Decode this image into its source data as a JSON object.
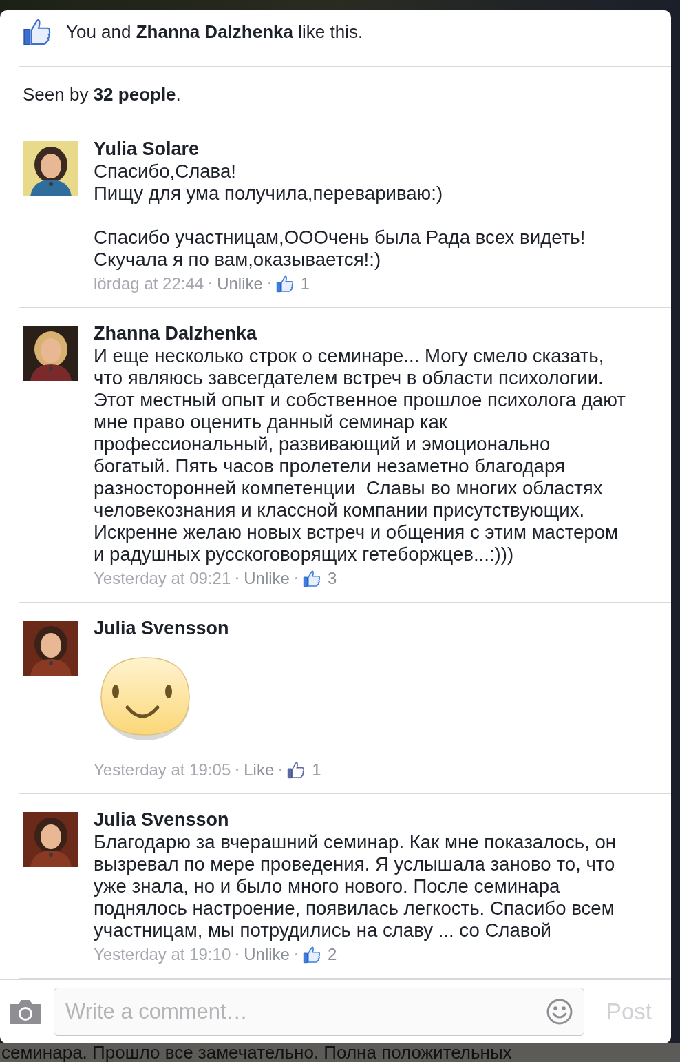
{
  "likes_summary": {
    "text": "You and **Zhanna Dalzhenka** like this."
  },
  "seen_by": {
    "text": "Seen by **32 people**."
  },
  "comments": [
    {
      "author": "Yulia Solare",
      "kind": "text",
      "body": "Спасибо,Слава!\nПищу для ума получила,перевариваю:)\n\nСпасибо участницам,ОООчень была Рада всех видеть!\nСкучала я по вам,оказывается!:)",
      "time": "lördag at 22:44",
      "action": "Unlike",
      "liked": true,
      "likes": "1"
    },
    {
      "author": "Zhanna Dalzhenka",
      "kind": "text",
      "body": "И еще несколько строк о семинаре... Могу смело сказать,\nчто являюсь завсегдателем встреч в области психологии.\nЭтот местный опыт и собственное прошлое психолога дают\nмне право оценить данный семинар как\nпрофессиональный, развивающий и эмоционально\nбогатый. Пять часов пролетели незаметно благодаря\nразносторонней компетенции  Славы во многих областях\nчеловекознания и классной компании присутствующих.\nИскренне желаю новых встреч и общения с этим мастером\nи радушных русскоговорящих гетеборжцев...:)))",
      "time": "Yesterday at 09:21",
      "action": "Unlike",
      "liked": true,
      "likes": "3"
    },
    {
      "author": "Julia Svensson",
      "kind": "sticker",
      "time": "Yesterday at 19:05",
      "action": "Like",
      "liked": false,
      "likes": "1"
    },
    {
      "author": "Julia Svensson",
      "kind": "text",
      "body": "Благодарю за вчерашний семинар. Как мне показалось, он\nвызревал по мере проведения. Я услышала заново то, что\nуже знала, но и было много нового. После семинара\nподнялось настроение, появилась легкость. Спасибо всем\nучастницам, мы потрудились на славу ... со Славой",
      "time": "Yesterday at 19:10",
      "action": "Unlike",
      "liked": true,
      "likes": "2"
    }
  ],
  "composer": {
    "placeholder": "Write a comment…",
    "post_button": {
      "label": "Post",
      "disabled": true
    }
  },
  "background_text": "семинара. Прошло все замечательно. Полна положительных"
}
